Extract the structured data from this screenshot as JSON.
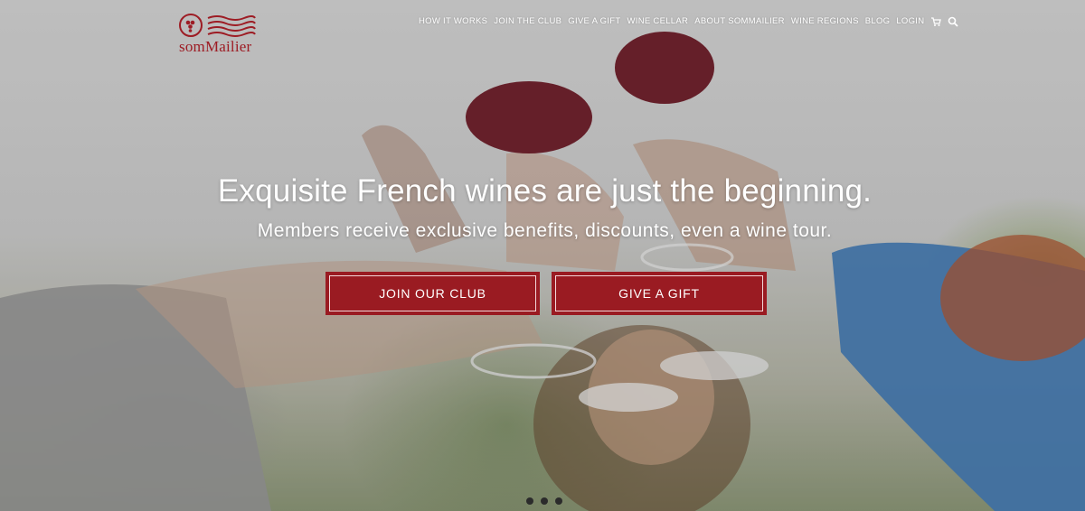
{
  "brand": {
    "name": "somMailier",
    "color": "#9d1c24"
  },
  "nav": {
    "items": [
      {
        "label": "HOW IT WORKS"
      },
      {
        "label": "JOIN THE CLUB"
      },
      {
        "label": "GIVE A GIFT"
      },
      {
        "label": "WINE CELLAR"
      },
      {
        "label": "ABOUT SOMMAILIER"
      },
      {
        "label": "WINE REGIONS"
      },
      {
        "label": "BLOG"
      },
      {
        "label": "LOGIN"
      }
    ],
    "icons": [
      "cart-icon",
      "search-icon"
    ]
  },
  "hero": {
    "headline": "Exquisite French wines are just the beginning.",
    "subheadline": "Members receive exclusive benefits, discounts, even a wine tour.",
    "buttons": {
      "join": "JOIN OUR CLUB",
      "gift": "GIVE A GIFT"
    },
    "slider": {
      "slide_count": 3,
      "active_slide": 3
    }
  },
  "colors": {
    "accent": "#9a1b22",
    "text": "#ffffff"
  }
}
